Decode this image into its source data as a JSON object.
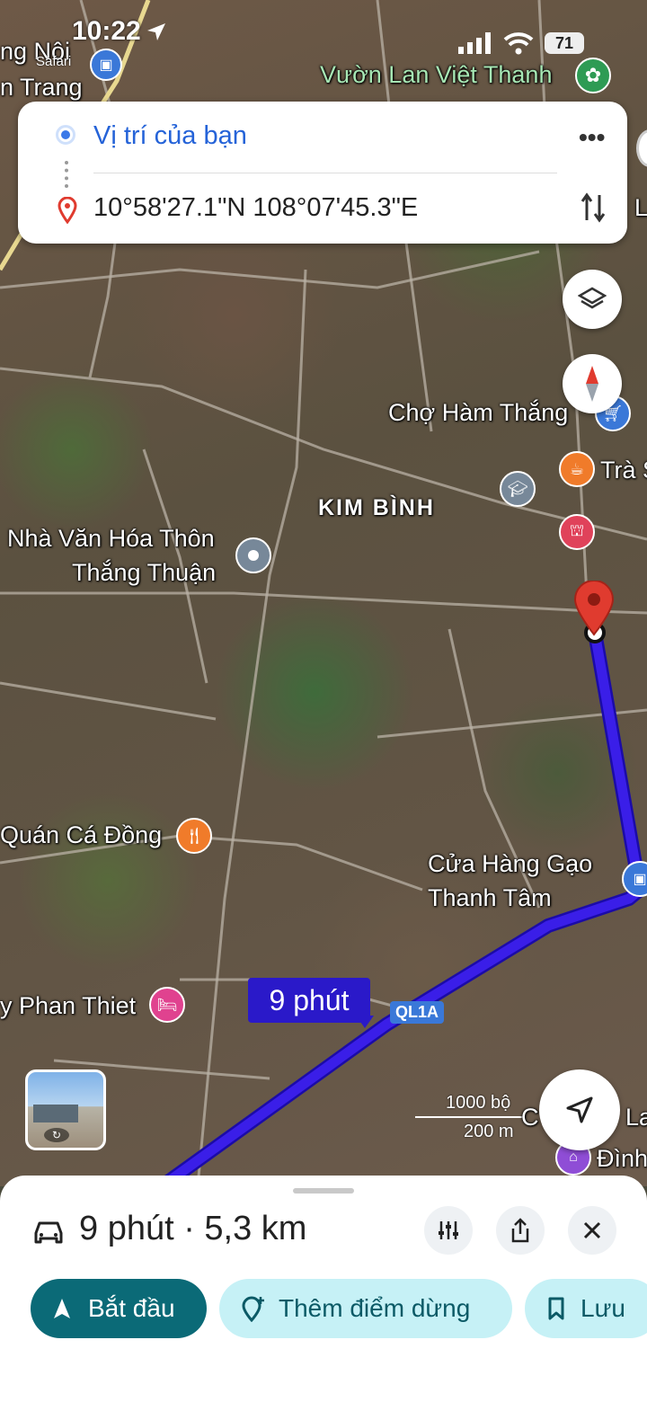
{
  "status_bar": {
    "time": "10:22",
    "back_app": "Safari",
    "battery": "71"
  },
  "directions_card": {
    "origin": "Vị trí của bạn",
    "destination": "10°58'27.1\"N 108°07'45.3\"E"
  },
  "map": {
    "labels": {
      "top_left_1": "ng Nội",
      "top_left_2": "n Trang",
      "vuon_lan": "Vườn Lan Việt Thanh",
      "cho": "Chợ Hàm Thắng",
      "tra": "Trà S",
      "kim_binh": "KIM BÌNH",
      "nha_van_hoa_1": "Nhà Văn Hóa Thôn",
      "nha_van_hoa_2": "Thắng Thuận",
      "quan_ca": "Quán Cá Đồng",
      "cua_hang_1": "Cửa Hàng Gạo",
      "cua_hang_2": "Thanh Tâm",
      "phan_thiet": "y Phan Thiet",
      "right_edge_1": "C",
      "right_edge_2": "La",
      "right_edge_3": "Đình",
      "right_top": "L"
    },
    "route_badge": "9 phút",
    "road_shield": "QL1A",
    "scale": {
      "feet": "1000 bộ",
      "meters": "200 m"
    },
    "route_color": "#3a1ee8"
  },
  "bottom_sheet": {
    "summary": "9 phút · 5,3 km",
    "start_label": "Bắt đầu",
    "add_stop_label": "Thêm điểm dừng",
    "save_label": "Lưu"
  },
  "colors": {
    "primary": "#0b6a77",
    "chip_bg": "#c6f1f6",
    "dest_pin": "#e03b2f"
  }
}
